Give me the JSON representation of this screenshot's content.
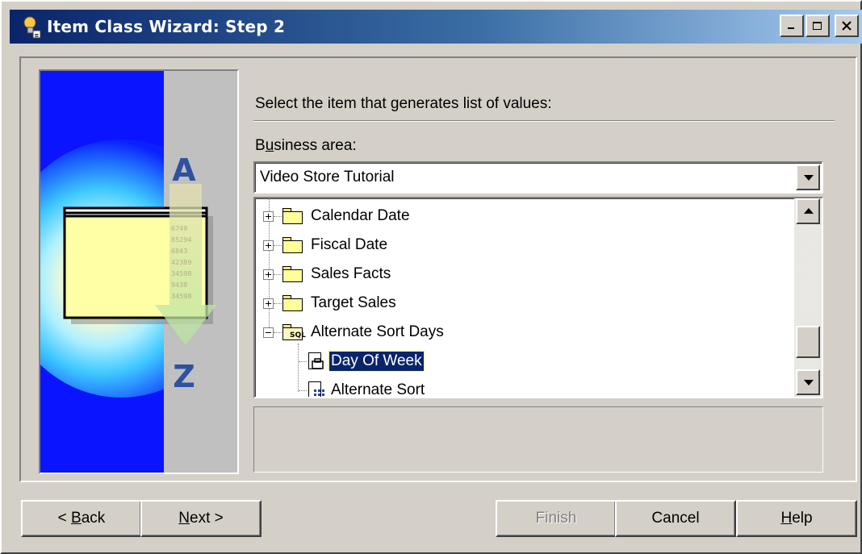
{
  "window": {
    "title": "Item Class Wizard: Step 2",
    "controls": {
      "minimize": "_",
      "maximize": "□",
      "close": "✕"
    }
  },
  "illustration": {
    "top_letter": "A",
    "bottom_letter": "Z",
    "numbers": [
      "6749",
      "85294",
      "6843",
      "42389",
      "34598",
      "9438",
      "34598"
    ]
  },
  "prompt": "Select the item that generates list of values:",
  "business_area": {
    "label_pre": "B",
    "label_mnemonic": "u",
    "label_post": "siness area:",
    "value": "Video Store Tutorial"
  },
  "tree": {
    "folders": [
      {
        "label": "Calendar Date",
        "expander": "plus"
      },
      {
        "label": "Fiscal Date",
        "expander": "plus"
      },
      {
        "label": "Sales Facts",
        "expander": "plus"
      },
      {
        "label": "Target Sales",
        "expander": "plus"
      },
      {
        "label": "Alternate Sort Days",
        "expander": "minus",
        "badge": "SQL"
      }
    ],
    "items": [
      {
        "label": "Day Of Week",
        "selected": true
      },
      {
        "label": "Alternate Sort",
        "selected": false
      }
    ]
  },
  "buttons": {
    "back": {
      "pre": "< ",
      "mnemonic": "B",
      "post": "ack"
    },
    "next": {
      "pre": "",
      "mnemonic": "N",
      "post": "ext >"
    },
    "finish": "Finish",
    "cancel": "Cancel",
    "help": {
      "pre": "",
      "mnemonic": "H",
      "post": "elp"
    }
  },
  "colors": {
    "titlebar_start": "#0a246a",
    "titlebar_end": "#a6caf0",
    "selection": "#0a246a",
    "face": "#d4d0c8"
  }
}
